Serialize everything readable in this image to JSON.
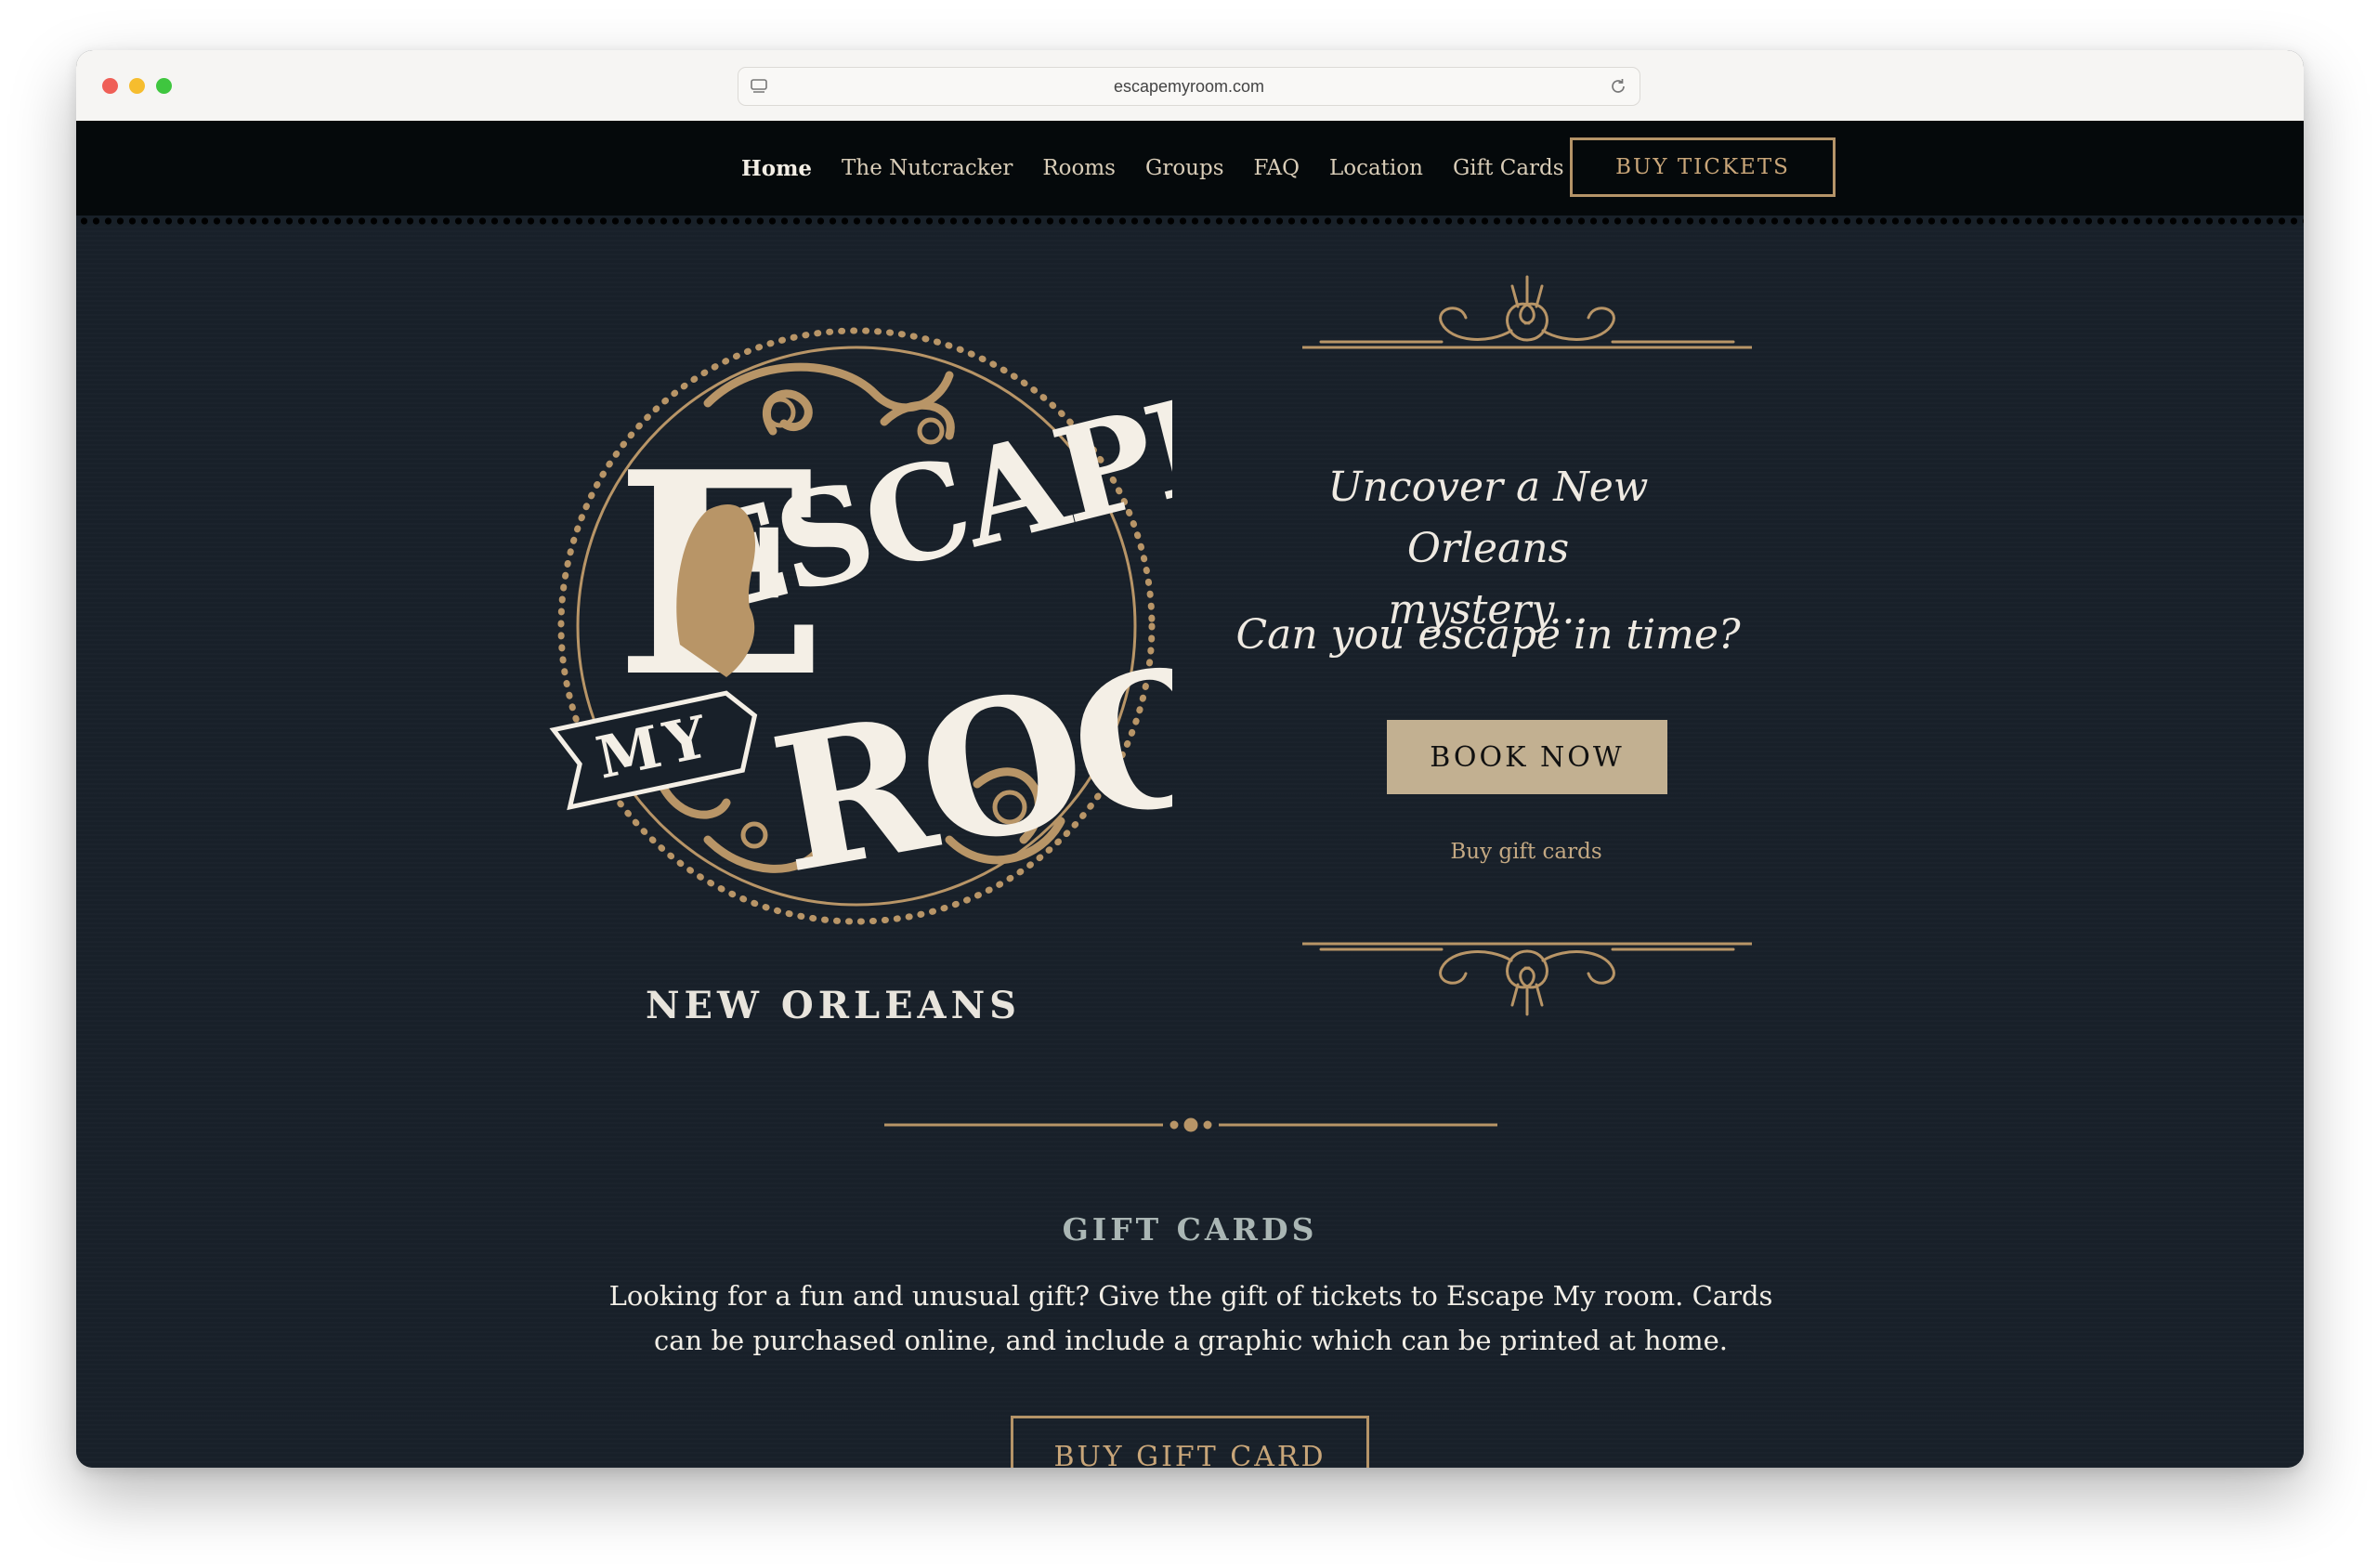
{
  "browser": {
    "url": "escapemyroom.com"
  },
  "nav": {
    "items": [
      {
        "label": "Home",
        "active": true
      },
      {
        "label": "The Nutcracker"
      },
      {
        "label": "Rooms"
      },
      {
        "label": "Groups"
      },
      {
        "label": "FAQ"
      },
      {
        "label": "Location"
      },
      {
        "label": "Gift Cards"
      }
    ],
    "cta": "BUY TICKETS"
  },
  "hero": {
    "logo": {
      "word1": "ESCAPE",
      "word2": "MY",
      "word3": "ROOM"
    },
    "city": "NEW ORLEANS",
    "tagline_line1": "Uncover a New Orleans",
    "tagline_line2": "mystery...",
    "tagline_question": "Can you escape in time?",
    "book_button": "BOOK NOW",
    "gift_link": "Buy gift cards"
  },
  "gift_section": {
    "heading": "GIFT CARDS",
    "body": "Looking for a fun and unusual gift? Give the gift of tickets to Escape My room. Cards can be purchased online, and include a graphic which can be printed at home.",
    "button": "BUY GIFT CARD"
  },
  "colors": {
    "nav_bg": "#05090b",
    "hero_bg": "#182029",
    "gold": "#b59468",
    "button_tan": "#c2b091",
    "cream": "#f4efe6"
  }
}
